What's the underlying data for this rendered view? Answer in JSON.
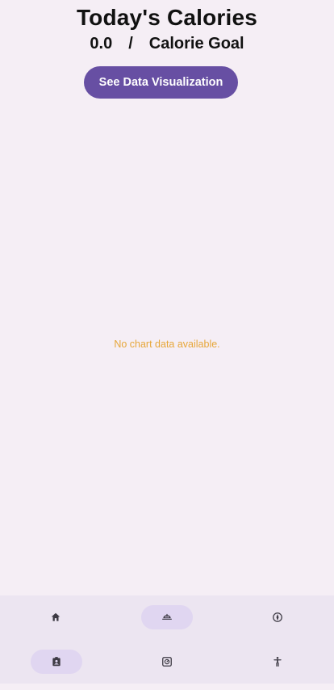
{
  "header": {
    "title": "Today's Calories",
    "consumed": "0.0",
    "separator": "/",
    "goal_label": "Calorie Goal"
  },
  "actions": {
    "visualize_label": "See Data Visualization"
  },
  "chart": {
    "empty_message": "No chart data available."
  },
  "bottom_nav": {
    "row1": [
      {
        "icon": "home-icon",
        "active": false
      },
      {
        "icon": "meal-bowl-icon",
        "active": true
      },
      {
        "icon": "compass-icon",
        "active": false
      }
    ],
    "row2": [
      {
        "icon": "profile-badge-icon",
        "active": true
      },
      {
        "icon": "scale-icon",
        "active": false
      },
      {
        "icon": "accessibility-icon",
        "active": false
      }
    ]
  },
  "colors": {
    "background": "#f5eef5",
    "accent_button": "#674fa3",
    "empty_message": "#e7a73a",
    "nav_background": "#ece5f1",
    "nav_active_pill": "#e0d6f1"
  }
}
